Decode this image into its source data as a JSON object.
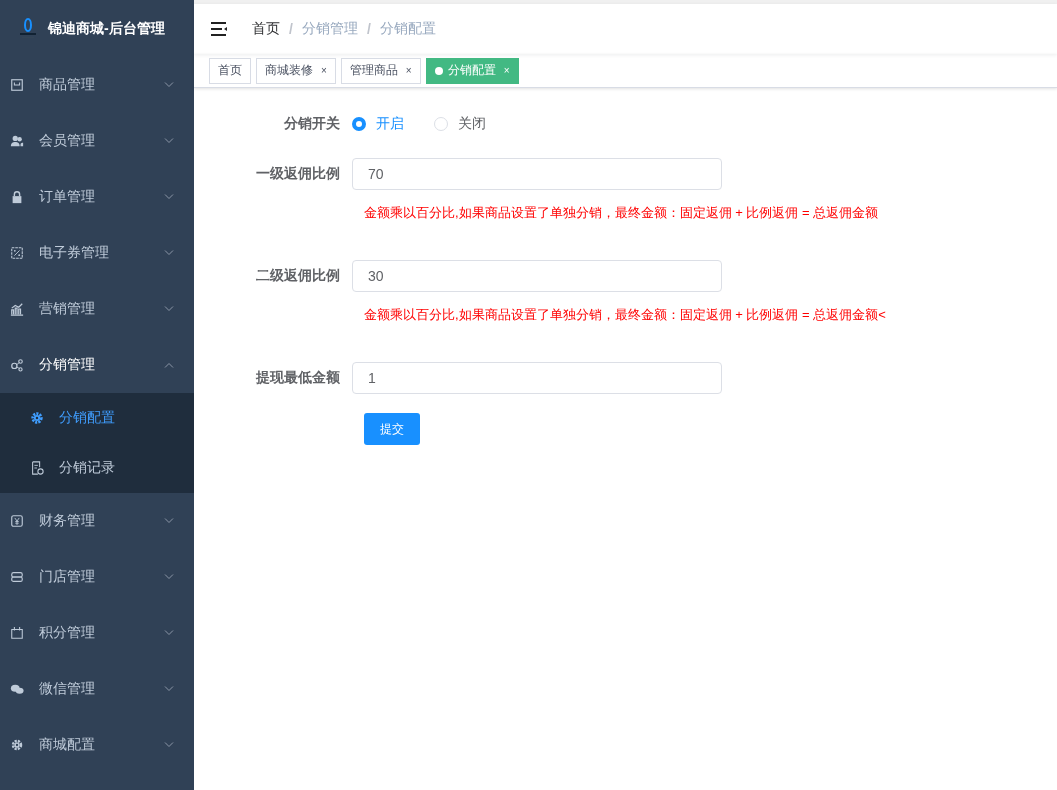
{
  "sidebar": {
    "title": "锦迪商城-后台管理",
    "items": [
      {
        "label": "商品管理",
        "expanded": false
      },
      {
        "label": "会员管理",
        "expanded": false
      },
      {
        "label": "订单管理",
        "expanded": false
      },
      {
        "label": "电子券管理",
        "expanded": false
      },
      {
        "label": "营销管理",
        "expanded": false
      },
      {
        "label": "分销管理",
        "expanded": true,
        "children": [
          {
            "label": "分销配置",
            "selected": true
          },
          {
            "label": "分销记录",
            "selected": false
          }
        ]
      },
      {
        "label": "财务管理",
        "expanded": false
      },
      {
        "label": "门店管理",
        "expanded": false
      },
      {
        "label": "积分管理",
        "expanded": false
      },
      {
        "label": "微信管理",
        "expanded": false
      },
      {
        "label": "商城配置",
        "expanded": false
      }
    ]
  },
  "breadcrumb": [
    {
      "label": "首页"
    },
    {
      "separator": "/",
      "label": "分销管理"
    },
    {
      "separator": "/",
      "label": "分销配置"
    }
  ],
  "tabs": [
    {
      "label": "首页",
      "selected": false
    },
    {
      "label": "商城装修",
      "selected": false,
      "close": "×"
    },
    {
      "label": "管理商品",
      "selected": false,
      "close": "×"
    },
    {
      "label": "分销配置",
      "selected": true,
      "close": "×"
    }
  ],
  "form": {
    "switch": {
      "label": "分销开关",
      "options": [
        {
          "label": "开启",
          "selected": true
        },
        {
          "label": "关闭",
          "selected": false
        }
      ]
    },
    "fields": [
      {
        "label": "一级返佣比例",
        "value": "70",
        "hint": "金额乘以百分比,如果商品设置了单独分销，最终金额：固定返佣 + 比例返佣 = 总返佣金额"
      },
      {
        "label": "二级返佣比例",
        "value": "30",
        "hint": "金额乘以百分比,如果商品设置了单独分销，最终金额：固定返佣 + 比例返佣 = 总返佣金额<"
      },
      {
        "label": "提现最低金额",
        "value": "1"
      }
    ],
    "submit": "提交"
  }
}
